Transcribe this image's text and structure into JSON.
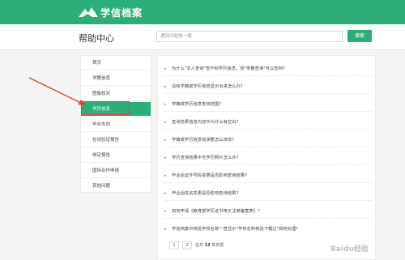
{
  "brand": {
    "name": "学信档案",
    "color": "#2bae7a"
  },
  "header": {
    "title": "帮助中心",
    "search_placeholder": "遇到问题搜一搜",
    "search_button": "搜索"
  },
  "sidebar": {
    "active_index": 3,
    "items": [
      {
        "label": "首页"
      },
      {
        "label": "学籍信息"
      },
      {
        "label": "图像校对"
      },
      {
        "label": "学历信息"
      },
      {
        "label": "毕业去向"
      },
      {
        "label": "在线验证报告"
      },
      {
        "label": "绑定报告"
      },
      {
        "label": "国际合作申请"
      },
      {
        "label": "其他问题"
      }
    ]
  },
  "questions": [
    {
      "text": "为什么\"本人查询\"查不到学历信息，而\"零散查询\"可以查到?"
    },
    {
      "text": "没有学籍或学历信息显示出来怎么办?"
    },
    {
      "text": "学籍或学历信息查询范围?"
    },
    {
      "text": "查询结果信息内容中为什么有空白?"
    },
    {
      "text": "学籍或学历信息有误要怎么修改?"
    },
    {
      "text": "学历查询结果中无学历照片怎么办?"
    },
    {
      "text": "毕业后证件号码变更是否影响查询结果?"
    },
    {
      "text": "毕业后姓名变更是否影响查询结果?"
    },
    {
      "text": "如何申请《教育部学历证书电子注册备案表》?"
    },
    {
      "text": "学信档案中核验学校名称一直显示\"学校名称核验下载过\"如何处理?"
    }
  ],
  "pagination": {
    "pages": [
      "1",
      "2"
    ],
    "total_prefix": "总共",
    "total_count": "13",
    "total_suffix": "条数据"
  },
  "watermark": "Baidu经验"
}
